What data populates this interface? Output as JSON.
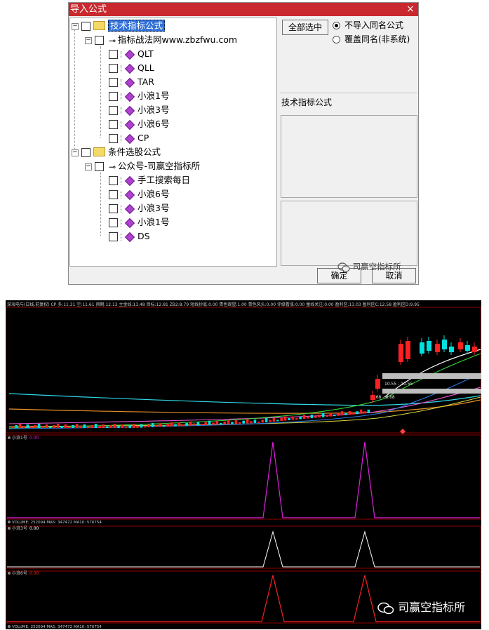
{
  "dialog": {
    "title": "导入公式",
    "close_glyph": "×",
    "tree": {
      "group1": {
        "label": "技术指标公式",
        "sub": {
          "label": "指标战法网www.zbzfwu.com",
          "items": [
            "QLT",
            "QLL",
            "TAR",
            "小浪1号",
            "小浪3号",
            "小浪6号",
            "CP"
          ]
        }
      },
      "group2": {
        "label": "条件选股公式",
        "sub": {
          "label": "公众号-司赢空指标所",
          "items": [
            "手工搜索每日",
            "小浪6号",
            "小浪3号",
            "小浪1号",
            "DS"
          ]
        }
      }
    },
    "select_all_label": "全部选中",
    "radio_skip_label": "不导入同名公式",
    "radio_overwrite_label": "覆盖同名(非系统)",
    "right_label": "技术指标公式",
    "ok_label": "确定",
    "cancel_label": "取消",
    "watermark": "司赢空指标所"
  },
  "chart": {
    "top_info": "深海电与(日线,前复权)  CP 多:11.31  空:11.61  预期:12.13  主金线:13.48  目标:12.81  ZB2:8.79  短线抄底:0.00  青色观望:1.00  青色风头:0.00  评级看涨:0.00  量线关注:0.00  盈利区:13.03  盈利区C:12.58  盈利区D:9.95",
    "price_tag_1": "10.55 - 10.55",
    "price_tag_2": "8.68 - 8.68",
    "panel1_label": "小浪1号",
    "panel1_value": "0.00",
    "volume_line": "VOLUME: 252094  MA5: 347472  MA10: 576754",
    "panel2_label": "小浪3号",
    "panel2_value": "0.00",
    "panel3_label": "小浪6号",
    "panel3_value": "0.00",
    "bottom_volume_line": "VOLUME: 252094  MA5: 347472  MA10: 576754",
    "watermark": "司赢空指标所",
    "colors": {
      "background": "#000000",
      "panel_border": "#8b0000",
      "panel1_line": "#e020e0",
      "panel2_line": "#ffffff",
      "panel3_line": "#ff2020",
      "candle_up": "#ff2020",
      "candle_down": "#00e0e0"
    }
  }
}
